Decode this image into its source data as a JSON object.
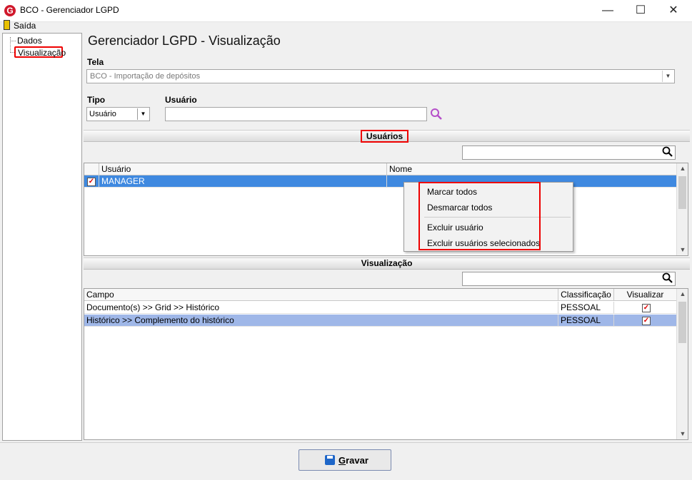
{
  "window": {
    "title": "BCO - Gerenciador LGPD",
    "minimize": "—",
    "maximize": "☐",
    "close": "✕"
  },
  "menu": {
    "exit_label": "Saída"
  },
  "tree": {
    "items": [
      {
        "label": "Dados"
      },
      {
        "label": "Visualização"
      }
    ]
  },
  "header": {
    "title": "Gerenciador LGPD - Visualização"
  },
  "form": {
    "tela_label": "Tela",
    "tela_value": "BCO - Importação de depósitos",
    "tipo_label": "Tipo",
    "tipo_value": "Usuário",
    "usuario_label": "Usuário",
    "usuario_value": ""
  },
  "usuarios_section": {
    "title": "Usuários",
    "search_value": "",
    "columns": [
      "Usuário",
      "Nome"
    ],
    "rows": [
      {
        "checked": true,
        "usuario": "MANAGER",
        "nome": ""
      }
    ]
  },
  "context_menu": {
    "items": [
      "Marcar todos",
      "Desmarcar todos",
      "Excluir usuário",
      "Excluir usuários selecionados"
    ]
  },
  "visualizacao_section": {
    "title": "Visualização",
    "search_value": "",
    "columns": [
      "Campo",
      "Classificação",
      "Visualizar"
    ],
    "rows": [
      {
        "campo": "Documento(s) >> Grid >> Histórico",
        "classificacao": "PESSOAL",
        "visualizar": true
      },
      {
        "campo": "Histórico >> Complemento do histórico",
        "classificacao": "PESSOAL",
        "visualizar": true
      }
    ]
  },
  "footer": {
    "save_label": "Gravar"
  },
  "colors": {
    "accent_red": "#e00000",
    "selection_blue": "#3f89e0",
    "selection_light": "#9fb7e8"
  }
}
